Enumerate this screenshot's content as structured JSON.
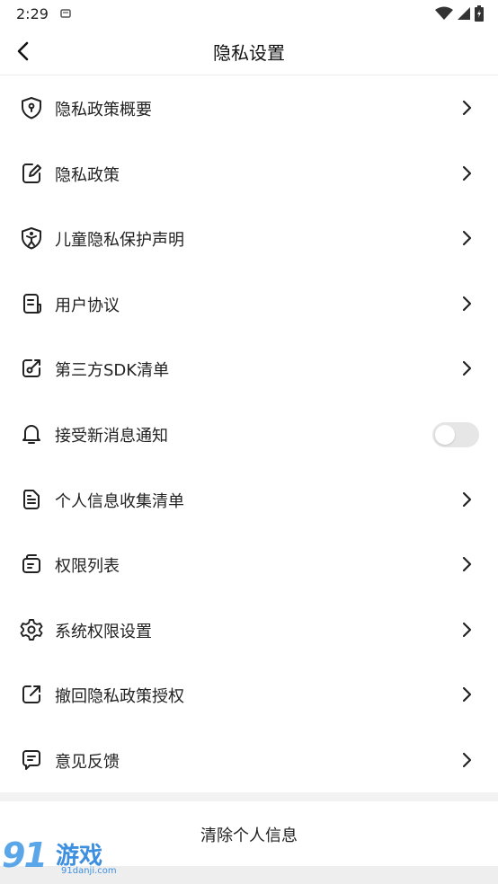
{
  "status": {
    "time": "2:29"
  },
  "header": {
    "title": "隐私设置"
  },
  "menu": {
    "items": [
      {
        "label": "隐私政策概要",
        "icon": "shield-lock-icon"
      },
      {
        "label": "隐私政策",
        "icon": "edit-note-icon"
      },
      {
        "label": "儿童隐私保护声明",
        "icon": "child-shield-icon"
      },
      {
        "label": "用户协议",
        "icon": "document-icon"
      },
      {
        "label": "第三方SDK清单",
        "icon": "external-edit-icon"
      },
      {
        "label": "接受新消息通知",
        "icon": "bell-icon",
        "toggle": false
      },
      {
        "label": "个人信息收集清单",
        "icon": "file-list-icon"
      },
      {
        "label": "权限列表",
        "icon": "permission-icon"
      },
      {
        "label": "系统权限设置",
        "icon": "gear-icon"
      },
      {
        "label": "撤回隐私政策授权",
        "icon": "share-out-icon"
      },
      {
        "label": "意见反馈",
        "icon": "feedback-icon"
      }
    ]
  },
  "actions": {
    "clear_label": "清除个人信息"
  },
  "watermark": {
    "num": "91",
    "name": "游戏",
    "url": "91danji.com"
  },
  "colors": {
    "accent": "#3d8fe0",
    "toggle_off": "#e6e6e6",
    "separator": "#f2f2f2"
  }
}
